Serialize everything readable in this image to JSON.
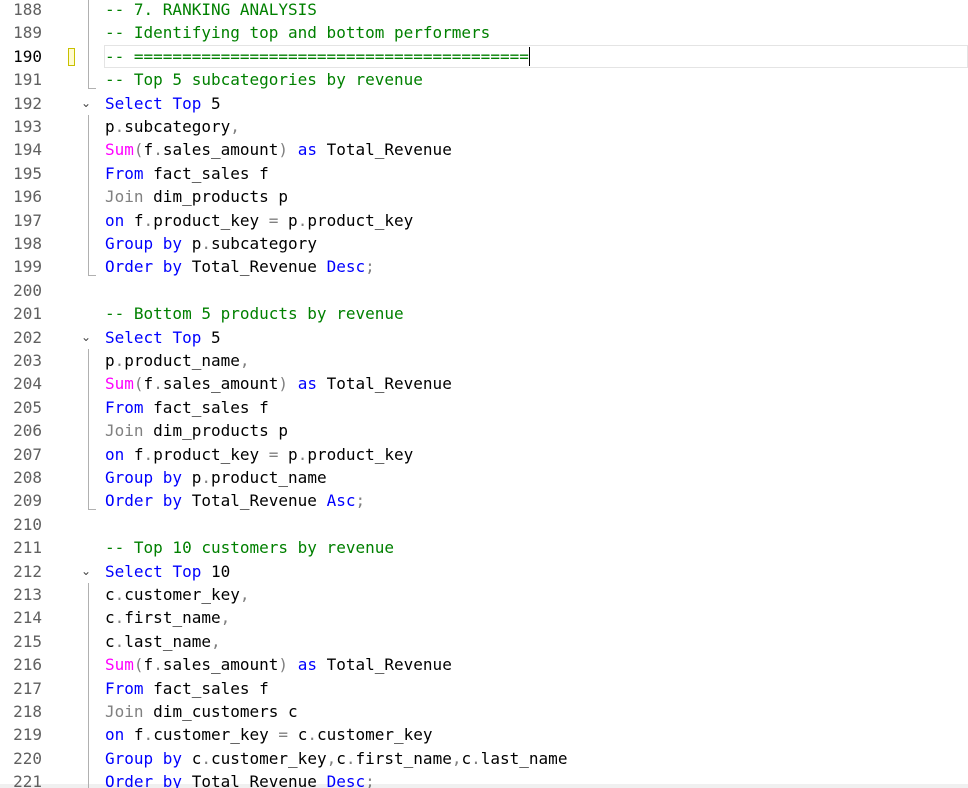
{
  "editor": {
    "lines": [
      {
        "num": "188",
        "tokens": [
          {
            "t": "-- 7. RANKING ANALYSIS",
            "c": "cm"
          }
        ]
      },
      {
        "num": "189",
        "tokens": [
          {
            "t": "-- Identifying top and bottom performers",
            "c": "cm"
          }
        ]
      },
      {
        "num": "190",
        "current": true,
        "marker": true,
        "tokens": [
          {
            "t": "-- =========================================",
            "c": "cm"
          }
        ],
        "caret": true
      },
      {
        "num": "191",
        "tokens": [
          {
            "t": "-- Top 5 subcategories by revenue",
            "c": "cm"
          }
        ]
      },
      {
        "num": "192",
        "fold": "⌄",
        "tokens": [
          {
            "t": "Select ",
            "c": "kw"
          },
          {
            "t": "Top ",
            "c": "kw"
          },
          {
            "t": "5",
            "c": "id"
          }
        ]
      },
      {
        "num": "193",
        "tokens": [
          {
            "t": "p",
            "c": "id"
          },
          {
            "t": ".",
            "c": "gr"
          },
          {
            "t": "subcategory",
            "c": "id"
          },
          {
            "t": ",",
            "c": "gr"
          }
        ]
      },
      {
        "num": "194",
        "tokens": [
          {
            "t": "Sum",
            "c": "fn"
          },
          {
            "t": "(",
            "c": "gr"
          },
          {
            "t": "f",
            "c": "id"
          },
          {
            "t": ".",
            "c": "gr"
          },
          {
            "t": "sales_amount",
            "c": "id"
          },
          {
            "t": ") ",
            "c": "gr"
          },
          {
            "t": "as ",
            "c": "kw"
          },
          {
            "t": "Total_Revenue",
            "c": "id"
          }
        ]
      },
      {
        "num": "195",
        "tokens": [
          {
            "t": "From ",
            "c": "kw"
          },
          {
            "t": "fact_sales f",
            "c": "id"
          }
        ]
      },
      {
        "num": "196",
        "tokens": [
          {
            "t": "Join ",
            "c": "gr"
          },
          {
            "t": "dim_products p",
            "c": "id"
          }
        ]
      },
      {
        "num": "197",
        "tokens": [
          {
            "t": "on ",
            "c": "kw"
          },
          {
            "t": "f",
            "c": "id"
          },
          {
            "t": ".",
            "c": "gr"
          },
          {
            "t": "product_key ",
            "c": "id"
          },
          {
            "t": "= ",
            "c": "gr"
          },
          {
            "t": "p",
            "c": "id"
          },
          {
            "t": ".",
            "c": "gr"
          },
          {
            "t": "product_key",
            "c": "id"
          }
        ]
      },
      {
        "num": "198",
        "tokens": [
          {
            "t": "Group ",
            "c": "kw"
          },
          {
            "t": "by ",
            "c": "kw"
          },
          {
            "t": "p",
            "c": "id"
          },
          {
            "t": ".",
            "c": "gr"
          },
          {
            "t": "subcategory",
            "c": "id"
          }
        ]
      },
      {
        "num": "199",
        "tokens": [
          {
            "t": "Order ",
            "c": "kw"
          },
          {
            "t": "by ",
            "c": "kw"
          },
          {
            "t": "Total_Revenue ",
            "c": "id"
          },
          {
            "t": "Desc",
            "c": "kw"
          },
          {
            "t": ";",
            "c": "gr"
          }
        ]
      },
      {
        "num": "200",
        "tokens": []
      },
      {
        "num": "201",
        "tokens": [
          {
            "t": "-- Bottom 5 products by revenue",
            "c": "cm"
          }
        ]
      },
      {
        "num": "202",
        "fold": "⌄",
        "tokens": [
          {
            "t": "Select ",
            "c": "kw"
          },
          {
            "t": "Top ",
            "c": "kw"
          },
          {
            "t": "5",
            "c": "id"
          }
        ]
      },
      {
        "num": "203",
        "tokens": [
          {
            "t": "p",
            "c": "id"
          },
          {
            "t": ".",
            "c": "gr"
          },
          {
            "t": "product_name",
            "c": "id"
          },
          {
            "t": ",",
            "c": "gr"
          }
        ]
      },
      {
        "num": "204",
        "tokens": [
          {
            "t": "Sum",
            "c": "fn"
          },
          {
            "t": "(",
            "c": "gr"
          },
          {
            "t": "f",
            "c": "id"
          },
          {
            "t": ".",
            "c": "gr"
          },
          {
            "t": "sales_amount",
            "c": "id"
          },
          {
            "t": ") ",
            "c": "gr"
          },
          {
            "t": "as ",
            "c": "kw"
          },
          {
            "t": "Total_Revenue",
            "c": "id"
          }
        ]
      },
      {
        "num": "205",
        "tokens": [
          {
            "t": "From ",
            "c": "kw"
          },
          {
            "t": "fact_sales f",
            "c": "id"
          }
        ]
      },
      {
        "num": "206",
        "tokens": [
          {
            "t": "Join ",
            "c": "gr"
          },
          {
            "t": "dim_products p",
            "c": "id"
          }
        ]
      },
      {
        "num": "207",
        "tokens": [
          {
            "t": "on ",
            "c": "kw"
          },
          {
            "t": "f",
            "c": "id"
          },
          {
            "t": ".",
            "c": "gr"
          },
          {
            "t": "product_key ",
            "c": "id"
          },
          {
            "t": "= ",
            "c": "gr"
          },
          {
            "t": "p",
            "c": "id"
          },
          {
            "t": ".",
            "c": "gr"
          },
          {
            "t": "product_key",
            "c": "id"
          }
        ]
      },
      {
        "num": "208",
        "tokens": [
          {
            "t": "Group ",
            "c": "kw"
          },
          {
            "t": "by ",
            "c": "kw"
          },
          {
            "t": "p",
            "c": "id"
          },
          {
            "t": ".",
            "c": "gr"
          },
          {
            "t": "product_name",
            "c": "id"
          }
        ]
      },
      {
        "num": "209",
        "tokens": [
          {
            "t": "Order ",
            "c": "kw"
          },
          {
            "t": "by ",
            "c": "kw"
          },
          {
            "t": "Total_Revenue ",
            "c": "id"
          },
          {
            "t": "Asc",
            "c": "kw"
          },
          {
            "t": ";",
            "c": "gr"
          }
        ]
      },
      {
        "num": "210",
        "tokens": []
      },
      {
        "num": "211",
        "tokens": [
          {
            "t": "-- Top 10 customers by revenue",
            "c": "cm"
          }
        ]
      },
      {
        "num": "212",
        "fold": "⌄",
        "tokens": [
          {
            "t": "Select ",
            "c": "kw"
          },
          {
            "t": "Top ",
            "c": "kw"
          },
          {
            "t": "10",
            "c": "id"
          }
        ]
      },
      {
        "num": "213",
        "tokens": [
          {
            "t": "c",
            "c": "id"
          },
          {
            "t": ".",
            "c": "gr"
          },
          {
            "t": "customer_key",
            "c": "id"
          },
          {
            "t": ",",
            "c": "gr"
          }
        ]
      },
      {
        "num": "214",
        "tokens": [
          {
            "t": "c",
            "c": "id"
          },
          {
            "t": ".",
            "c": "gr"
          },
          {
            "t": "first_name",
            "c": "id"
          },
          {
            "t": ",",
            "c": "gr"
          }
        ]
      },
      {
        "num": "215",
        "tokens": [
          {
            "t": "c",
            "c": "id"
          },
          {
            "t": ".",
            "c": "gr"
          },
          {
            "t": "last_name",
            "c": "id"
          },
          {
            "t": ",",
            "c": "gr"
          }
        ]
      },
      {
        "num": "216",
        "tokens": [
          {
            "t": "Sum",
            "c": "fn"
          },
          {
            "t": "(",
            "c": "gr"
          },
          {
            "t": "f",
            "c": "id"
          },
          {
            "t": ".",
            "c": "gr"
          },
          {
            "t": "sales_amount",
            "c": "id"
          },
          {
            "t": ") ",
            "c": "gr"
          },
          {
            "t": "as ",
            "c": "kw"
          },
          {
            "t": "Total_Revenue",
            "c": "id"
          }
        ]
      },
      {
        "num": "217",
        "tokens": [
          {
            "t": "From ",
            "c": "kw"
          },
          {
            "t": "fact_sales f",
            "c": "id"
          }
        ]
      },
      {
        "num": "218",
        "tokens": [
          {
            "t": "Join ",
            "c": "gr"
          },
          {
            "t": "dim_customers c",
            "c": "id"
          }
        ]
      },
      {
        "num": "219",
        "tokens": [
          {
            "t": "on ",
            "c": "kw"
          },
          {
            "t": "f",
            "c": "id"
          },
          {
            "t": ".",
            "c": "gr"
          },
          {
            "t": "customer_key ",
            "c": "id"
          },
          {
            "t": "= ",
            "c": "gr"
          },
          {
            "t": "c",
            "c": "id"
          },
          {
            "t": ".",
            "c": "gr"
          },
          {
            "t": "customer_key",
            "c": "id"
          }
        ]
      },
      {
        "num": "220",
        "tokens": [
          {
            "t": "Group ",
            "c": "kw"
          },
          {
            "t": "by ",
            "c": "kw"
          },
          {
            "t": "c",
            "c": "id"
          },
          {
            "t": ".",
            "c": "gr"
          },
          {
            "t": "customer_key",
            "c": "id"
          },
          {
            "t": ",",
            "c": "gr"
          },
          {
            "t": "c",
            "c": "id"
          },
          {
            "t": ".",
            "c": "gr"
          },
          {
            "t": "first_name",
            "c": "id"
          },
          {
            "t": ",",
            "c": "gr"
          },
          {
            "t": "c",
            "c": "id"
          },
          {
            "t": ".",
            "c": "gr"
          },
          {
            "t": "last_name",
            "c": "id"
          }
        ]
      },
      {
        "num": "221",
        "tokens": [
          {
            "t": "Order ",
            "c": "kw"
          },
          {
            "t": "by ",
            "c": "kw"
          },
          {
            "t": "Total_Revenue ",
            "c": "id"
          },
          {
            "t": "Desc",
            "c": "kw"
          },
          {
            "t": ";",
            "c": "gr"
          }
        ]
      }
    ]
  },
  "colors": {
    "keyword": "#0000ff",
    "function": "#ff00ff",
    "comment": "#008000",
    "punctuation": "#808080",
    "identifier": "#000000",
    "change_marker": "#c8c000"
  },
  "icons": {
    "fold": "chevron-down-icon",
    "marker": "change-marker-icon"
  }
}
